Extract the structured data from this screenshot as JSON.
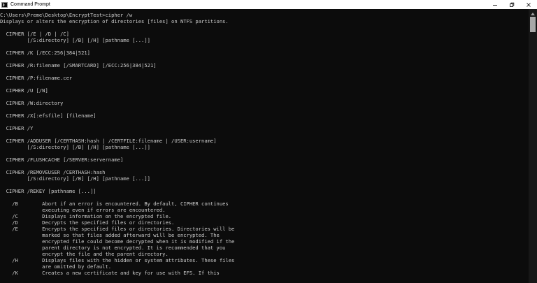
{
  "window": {
    "title": "Command Prompt",
    "icon": "terminal-icon",
    "buttons": [
      "minimize-icon",
      "maximize-icon",
      "close-icon"
    ]
  },
  "colors": {
    "background": "#0c0c0c",
    "text": "#cccccc",
    "titlebar": "#ffffff"
  },
  "console": {
    "lines": [
      "C:\\Users\\Preme\\Desktop\\EncryptTest>cipher /w",
      "Displays or alters the encryption of directories [files] on NTFS partitions.",
      "",
      "  CIPHER [/E | /D | /C]",
      "         [/S:directory] [/B] [/H] [pathname [...]]",
      "",
      "  CIPHER /K [/ECC:256|384|521]",
      "",
      "  CIPHER /R:filename [/SMARTCARD] [/ECC:256|384|521]",
      "",
      "  CIPHER /P:filename.cer",
      "",
      "  CIPHER /U [/N]",
      "",
      "  CIPHER /W:directory",
      "",
      "  CIPHER /X[:efsfile] [filename]",
      "",
      "  CIPHER /Y",
      "",
      "  CIPHER /ADDUSER [/CERTHASH:hash | /CERTFILE:filename | /USER:username]",
      "         [/S:directory] [/B] [/H] [pathname [...]]",
      "",
      "  CIPHER /FLUSHCACHE [/SERVER:servername]",
      "",
      "  CIPHER /REMOVEUSER /CERTHASH:hash",
      "         [/S:directory] [/B] [/H] [pathname [...]]",
      "",
      "  CIPHER /REKEY [pathname [...]]",
      "",
      "    /B        Abort if an error is encountered. By default, CIPHER continues",
      "              executing even if errors are encountered.",
      "    /C        Displays information on the encrypted file.",
      "    /D        Decrypts the specified files or directories.",
      "    /E        Encrypts the specified files or directories. Directories will be",
      "              marked so that files added afterward will be encrypted. The",
      "              encrypted file could become decrypted when it is modified if the",
      "              parent directory is not encrypted. It is recommended that you",
      "              encrypt the file and the parent directory.",
      "    /H        Displays files with the hidden or system attributes. These files",
      "              are omitted by default.",
      "    /K        Creates a new certificate and key for use with EFS. If this"
    ]
  }
}
